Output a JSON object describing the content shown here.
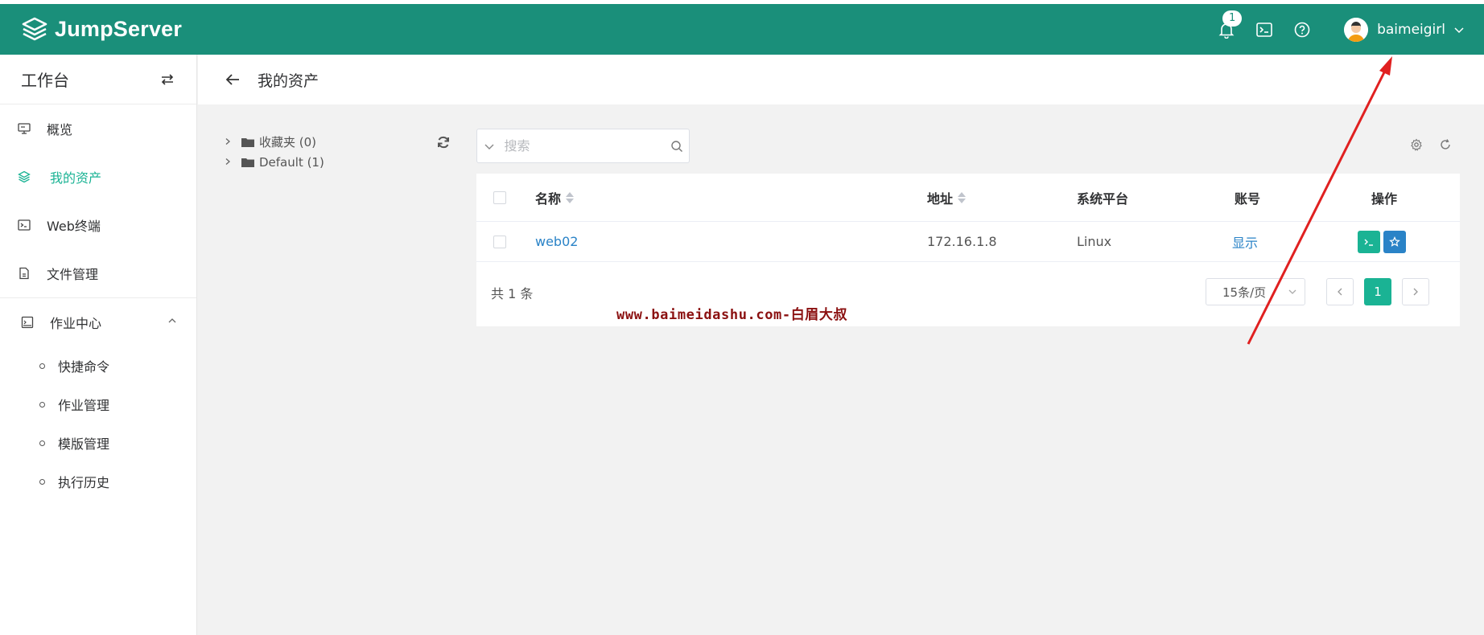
{
  "app": {
    "name": "JumpServer"
  },
  "header": {
    "notification_count": "1",
    "username": "baimeigirl"
  },
  "sidebar": {
    "title": "工作台",
    "items": [
      {
        "label": "概览",
        "icon": "monitor-icon"
      },
      {
        "label": "我的资产",
        "icon": "layers-icon",
        "active": true
      },
      {
        "label": "Web终端",
        "icon": "terminal-icon"
      },
      {
        "label": "文件管理",
        "icon": "file-icon"
      },
      {
        "label": "作业中心",
        "icon": "task-icon"
      }
    ],
    "sub_items": [
      {
        "label": "快捷命令"
      },
      {
        "label": "作业管理"
      },
      {
        "label": "模版管理"
      },
      {
        "label": "执行历史"
      }
    ]
  },
  "page": {
    "title": "我的资产"
  },
  "tree": {
    "nodes": [
      {
        "label": "收藏夹 (0)"
      },
      {
        "label": "Default (1)"
      }
    ]
  },
  "search": {
    "placeholder": "搜索",
    "value": ""
  },
  "table": {
    "columns": [
      "名称",
      "地址",
      "系统平台",
      "账号",
      "操作"
    ],
    "rows": [
      {
        "name": "web02",
        "address": "172.16.1.8",
        "platform": "Linux",
        "account": "显示"
      }
    ]
  },
  "pagination": {
    "total_text": "共 1 条",
    "page_size": "15条/页",
    "current_page": "1"
  },
  "watermark": "www.baimeidashu.com-白眉大叔",
  "colors": {
    "header_bg": "#1a8f7a",
    "accent": "#1ab394",
    "link": "#2a83c7",
    "annotation_arrow": "#e02020"
  }
}
